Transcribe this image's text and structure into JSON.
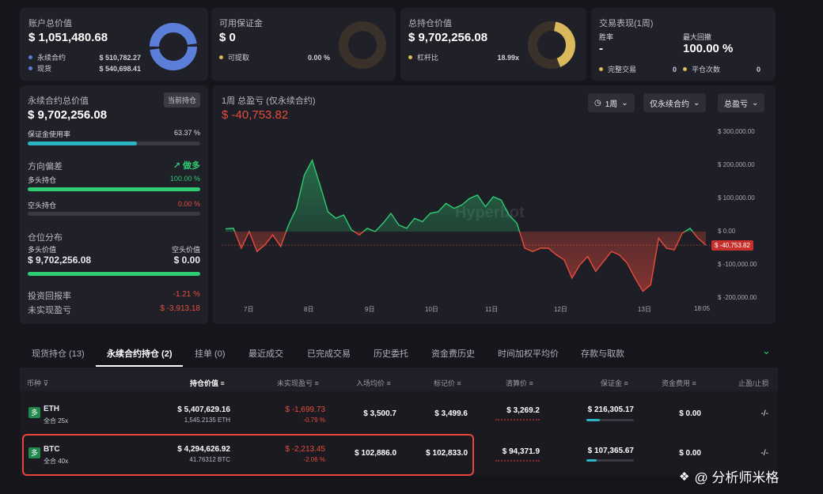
{
  "account": {
    "title": "账户总价值",
    "value": "$ 1,051,480.68",
    "rows": [
      {
        "label": "永续合约",
        "value": "$ 510,782.27",
        "color": "#5b7fd9"
      },
      {
        "label": "现货",
        "value": "$ 540,698.41",
        "color": "#5b7fd9"
      }
    ]
  },
  "margin": {
    "title": "可用保证金",
    "value": "$ 0",
    "row": {
      "label": "可提取",
      "value": "0.00 %",
      "color": "#d9b95b"
    }
  },
  "position": {
    "title": "总持仓价值",
    "value": "$ 9,702,256.08",
    "row": {
      "label": "杠杆比",
      "value": "18.99x",
      "color": "#d9b95b"
    }
  },
  "performance": {
    "title": "交易表现(1周)",
    "win_label": "胜率",
    "win_value": "-",
    "drawdown_label": "最大回撤",
    "drawdown_value": "100.00 %",
    "done_label": "完整交易",
    "done_value": "0",
    "close_label": "平仓次数",
    "close_value": "0"
  },
  "perp": {
    "title": "永续合约总价值",
    "badge": "当前持仓",
    "value": "$ 9,702,256.08",
    "usage_label": "保证金使用率",
    "usage_value": "63.37 %",
    "usage_pct": 0.6337,
    "bias_title": "方向偏差",
    "bias_value": "做多",
    "long_label": "多头持仓",
    "long_value": "100.00 %",
    "long_pct": 1.0,
    "short_label": "空头持仓",
    "short_value": "0.00 %",
    "short_pct": 0.0,
    "dist_title": "仓位分布",
    "long_val_label": "多头价值",
    "long_val": "$ 9,702,256.08",
    "short_val_label": "空头价值",
    "short_val": "$ 0.00",
    "roi_label": "投资回报率",
    "roi_value": "-1.21 %",
    "upnl_label": "未实现盈亏",
    "upnl_value": "$ -3,913.18"
  },
  "chart_panel": {
    "title": "1周 总盈亏 (仅永续合约)",
    "value": "$ -40,753.82",
    "period": "1周",
    "scope": "仅永续合约",
    "metric": "总盈亏",
    "watermark": "Hyperbot",
    "marker": "$ -40,753.82"
  },
  "chart_data": {
    "type": "area",
    "x_ticks": [
      "7日",
      "8日",
      "9日",
      "10日",
      "11日",
      "12日",
      "13日",
      "18:05"
    ],
    "y_ticks": [
      "$ 300,000.00",
      "$ 200,000.00",
      "$ 100,000.00",
      "$ 0.00",
      "$ -100,000.00",
      "$ -200,000.00"
    ],
    "ylim": [
      -200000,
      300000
    ],
    "values": [
      8000,
      10000,
      -50000,
      0,
      -60000,
      -40000,
      -10000,
      -45000,
      20000,
      70000,
      170000,
      215000,
      140000,
      60000,
      40000,
      50000,
      5000,
      -10000,
      10000,
      0,
      25000,
      55000,
      20000,
      10000,
      40000,
      30000,
      55000,
      60000,
      85000,
      70000,
      80000,
      100000,
      110000,
      75000,
      105000,
      95000,
      50000,
      25000,
      -50000,
      -60000,
      -50000,
      -50000,
      -70000,
      -85000,
      -140000,
      -100000,
      -75000,
      -120000,
      -90000,
      -60000,
      -70000,
      -95000,
      -140000,
      -180000,
      -160000,
      -20000,
      -50000,
      -55000,
      -5000,
      10000,
      -20000,
      -40753
    ]
  },
  "tabs": [
    "现货持仓 (13)",
    "永续合约持仓 (2)",
    "挂单 (0)",
    "最近成交",
    "已完成交易",
    "历史委托",
    "资金费历史",
    "时间加权平均价",
    "存款与取款"
  ],
  "table": {
    "headers": [
      "币种",
      "持仓价值",
      "未实现盈亏",
      "入场均价",
      "标记价",
      "清算价",
      "保证金",
      "资金费用",
      "止盈/止损"
    ],
    "rows": [
      {
        "coin": "ETH",
        "mode": "全合 25x",
        "tag": "多",
        "value": "$ 5,407,629.16",
        "qty": "1,545.2135 ETH",
        "pnl": "$ -1,699.73",
        "pnl_pct": "-0.79 %",
        "entry": "$ 3,500.7",
        "mark": "$ 3,499.6",
        "liq": "$ 3,269.2",
        "margin": "$ 216,305.17",
        "margin_pct": 0.28,
        "funding": "$ 0.00",
        "tpsl": "-/-"
      },
      {
        "coin": "BTC",
        "mode": "全合 40x",
        "tag": "多",
        "value": "$ 4,294,626.92",
        "qty": "41.76312 BTC",
        "pnl": "$ -2,213.45",
        "pnl_pct": "-2.06 %",
        "entry": "$ 102,886.0",
        "mark": "$ 102,833.0",
        "liq": "$ 94,371.9",
        "margin": "$ 107,365.67",
        "margin_pct": 0.22,
        "funding": "$ 0.00",
        "tpsl": "-/-"
      }
    ]
  },
  "watermark_footer": "@ 分析师米格",
  "colors": {
    "accent_green": "#2ecc71",
    "accent_red": "#e74c3c",
    "highlight": "#e8453c"
  }
}
